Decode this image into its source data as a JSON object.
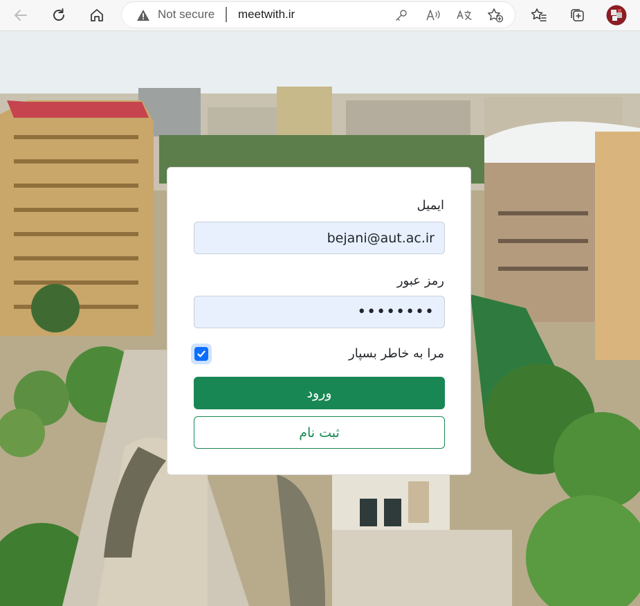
{
  "browser": {
    "security_label": "Not secure",
    "url": "meetwith.ir",
    "icons": {
      "back": "back-arrow-icon",
      "refresh": "refresh-icon",
      "home": "home-icon",
      "warning": "warning-icon",
      "password": "key-icon",
      "read_aloud": "read-aloud-icon",
      "translate": "translate-icon",
      "add_favorite": "star-plus-icon",
      "favorites": "favorites-icon",
      "collections": "collections-icon",
      "profile": "profile-avatar-icon"
    }
  },
  "login": {
    "email_label": "ایمیل",
    "email_value": "bejani@aut.ac.ir",
    "password_label": "رمز عبور",
    "password_value": "••••••••",
    "remember_label": "مرا به خاطر بسپار",
    "remember_checked": true,
    "login_button": "ورود",
    "register_button": "ثبت نام"
  },
  "colors": {
    "primary_button": "#198754",
    "checkbox": "#0d6efd",
    "input_fill": "#e8f0fe"
  }
}
